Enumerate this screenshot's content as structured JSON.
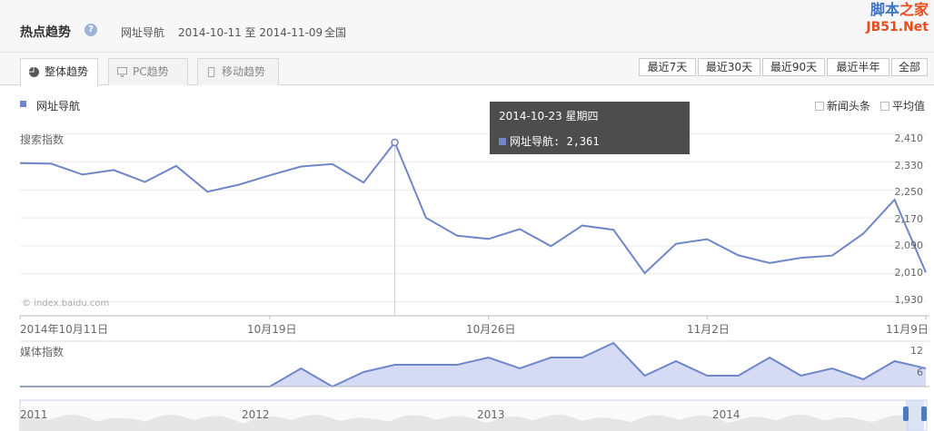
{
  "header": {
    "title": "热点趋势",
    "help": "?",
    "keyword": "网址导航",
    "date_range": "2014-10-11 至 2014-11-09",
    "region": "全国",
    "logo_top_a": "脚本",
    "logo_top_b": "之家",
    "logo_bottom": "JB51.Net"
  },
  "tabs": [
    {
      "label": "整体趋势"
    },
    {
      "label": "PC趋势"
    },
    {
      "label": "移动趋势"
    }
  ],
  "ranges": [
    "最近7天",
    "最近30天",
    "最近90天",
    "最近半年",
    "全部"
  ],
  "legend": {
    "series": "网址导航"
  },
  "options": {
    "news": "新闻头条",
    "avg": "平均值"
  },
  "search_panel": {
    "label": "搜索指数",
    "watermark": "© index.baidu.com",
    "y_ticks": [
      "2,410",
      "2,330",
      "2,250",
      "2,170",
      "2,090",
      "2,010",
      "1,930"
    ],
    "x_ticks": [
      "2014年10月11日",
      "10月19日",
      "10月26日",
      "11月2日",
      "11月9日"
    ]
  },
  "media_panel": {
    "label": "媒体指数",
    "y_ticks": [
      "12",
      "6"
    ]
  },
  "overview": {
    "year_labels": [
      "2011",
      "2012",
      "2013",
      "2014"
    ]
  },
  "tooltip": {
    "date": "2014-10-23 星期四",
    "series": "网址导航",
    "value_text": "2,361"
  },
  "colors": {
    "line": "#6f86c8",
    "media_fill": "#d5daf5",
    "tooltip_bg": "#4d4d4d"
  },
  "chart_data": [
    {
      "type": "line",
      "title": "搜索指数",
      "series": [
        {
          "name": "网址导航",
          "values": [
            2327,
            2325,
            2294,
            2307,
            2273,
            2319,
            2245,
            2265,
            2292,
            2317,
            2324,
            2271,
            2386,
            2170,
            2119,
            2110,
            2138,
            2089,
            2148,
            2136,
            2012,
            2096,
            2109,
            2063,
            2041,
            2056,
            2062,
            2125,
            2222,
            2014
          ]
        }
      ],
      "x": [
        "2014-10-11",
        "2014-10-12",
        "2014-10-13",
        "2014-10-14",
        "2014-10-15",
        "2014-10-16",
        "2014-10-17",
        "2014-10-18",
        "2014-10-19",
        "2014-10-20",
        "2014-10-21",
        "2014-10-22",
        "2014-10-23",
        "2014-10-24",
        "2014-10-25",
        "2014-10-26",
        "2014-10-27",
        "2014-10-28",
        "2014-10-29",
        "2014-10-30",
        "2014-10-31",
        "2014-11-01",
        "2014-11-02",
        "2014-11-03",
        "2014-11-04",
        "2014-11-05",
        "2014-11-06",
        "2014-11-07",
        "2014-11-08",
        "2014-11-09"
      ],
      "ylim": [
        1890,
        2430
      ],
      "grid": true
    },
    {
      "type": "area",
      "title": "媒体指数",
      "series": [
        {
          "name": "网址导航",
          "values": [
            0,
            0,
            0,
            0,
            0,
            0,
            0,
            0,
            0,
            5,
            0,
            4,
            6,
            6,
            6,
            8,
            5,
            8,
            8,
            12,
            3,
            7,
            3,
            3,
            8,
            3,
            5,
            2,
            7,
            5
          ]
        }
      ],
      "ylim": [
        0,
        12
      ]
    }
  ]
}
